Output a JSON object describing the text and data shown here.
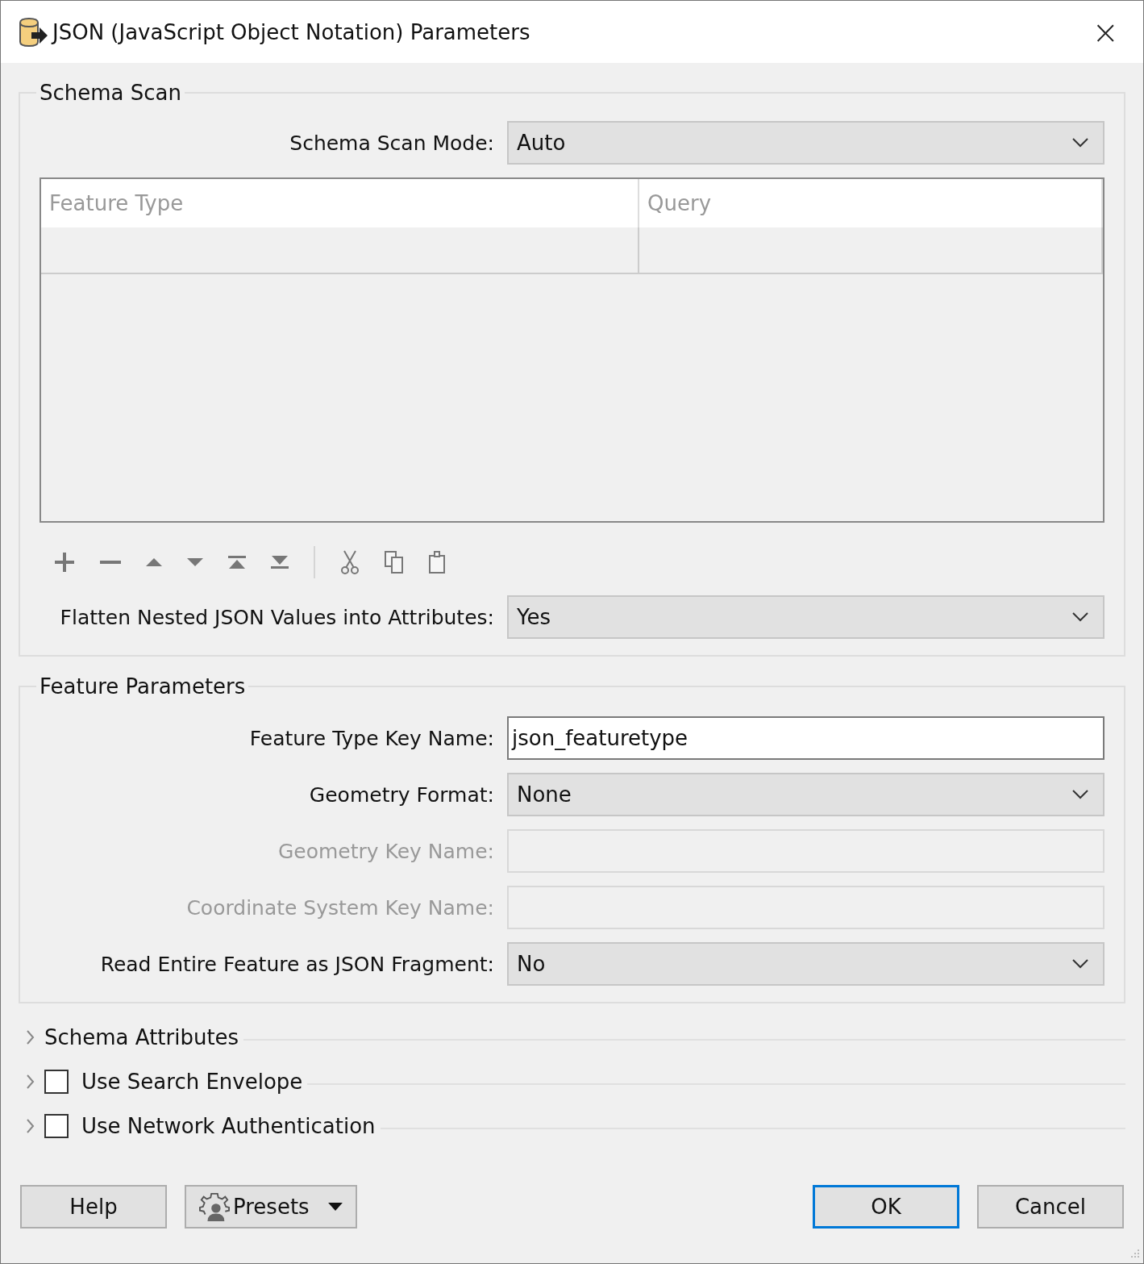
{
  "window": {
    "title": "JSON (JavaScript Object Notation) Parameters",
    "close": "×"
  },
  "schema_scan": {
    "title": "Schema Scan",
    "fields": [
      {
        "label": "Schema Scan Mode:",
        "kind": "dropdown",
        "value": "Auto",
        "disabled": false
      }
    ],
    "table": {
      "columns": [
        "Feature Type",
        "Query"
      ]
    },
    "after_fields": [
      {
        "label": "Flatten Nested JSON Values into Attributes:",
        "kind": "dropdown",
        "value": "Yes",
        "disabled": false
      }
    ]
  },
  "feature_parameters": {
    "title": "Feature Parameters",
    "fields": [
      {
        "label": "Feature Type Key Name:",
        "kind": "text",
        "value": "json_featuretype",
        "disabled": false
      },
      {
        "label": "Geometry Format:",
        "kind": "dropdown",
        "value": "None",
        "disabled": false
      },
      {
        "label": "Geometry Key Name:",
        "kind": "text",
        "disabled": true
      },
      {
        "label": "Coordinate System Key Name:",
        "kind": "text",
        "disabled": true
      },
      {
        "label": "Read Entire Feature as JSON Fragment:",
        "kind": "dropdown",
        "value": "No",
        "disabled": false
      }
    ]
  },
  "sections": [
    {
      "label": "Schema Attributes",
      "kind": "plain",
      "expanded": false
    },
    {
      "label": "Use Search Envelope",
      "kind": "checkbox",
      "checked": false,
      "expanded": false
    },
    {
      "label": "Use Network Authentication",
      "kind": "checkbox",
      "checked": false,
      "expanded": false
    }
  ],
  "buttons": [
    {
      "label": "Help",
      "kind": "plain"
    },
    {
      "label": "Presets",
      "kind": "presets"
    },
    {
      "label": "OK",
      "kind": "default"
    },
    {
      "label": "Cancel",
      "kind": "plain"
    }
  ]
}
